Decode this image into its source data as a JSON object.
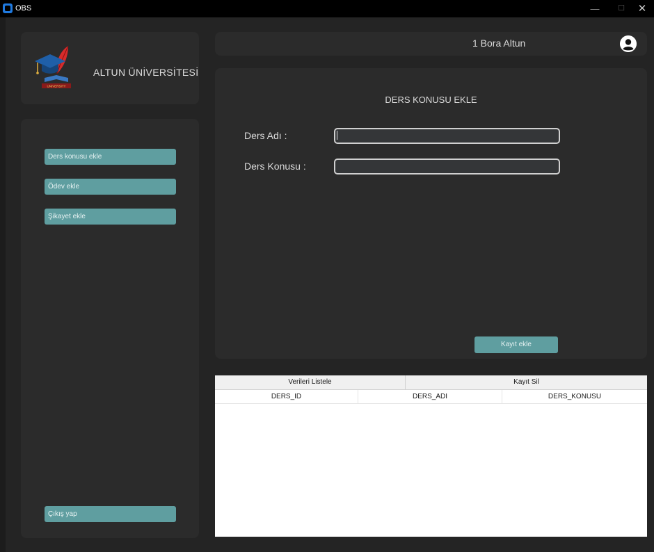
{
  "window": {
    "title": "OBS",
    "minimize": "—",
    "maximize": "☐",
    "close": "✕"
  },
  "logo": {
    "university_name": "ALTUN ÜNİVERSİTESİ",
    "badge_text": "UNIVERSITY"
  },
  "sidebar": {
    "items": [
      {
        "label": "Ders konusu ekle"
      },
      {
        "label": "Ödev ekle"
      },
      {
        "label": "Şikayet ekle"
      }
    ],
    "logout_label": "Çıkış yap"
  },
  "user": {
    "display": "1  Bora Altun",
    "icon": "user-avatar-icon"
  },
  "form": {
    "title": "DERS KONUSU EKLE",
    "course_name_label": "Ders Adı :",
    "course_name_value": "",
    "topic_label": "Ders Konusu :",
    "topic_value": "",
    "submit_label": "Kayıt ekle"
  },
  "table": {
    "tabs": [
      {
        "label": "Verileri Listele"
      },
      {
        "label": "Kayıt Sil"
      }
    ],
    "columns": [
      "DERS_ID",
      "DERS_ADI",
      "DERS_KONUSU"
    ],
    "rows": []
  },
  "colors": {
    "accent": "#5f9ea0",
    "panel": "#2b2b2b",
    "background": "#242424"
  }
}
